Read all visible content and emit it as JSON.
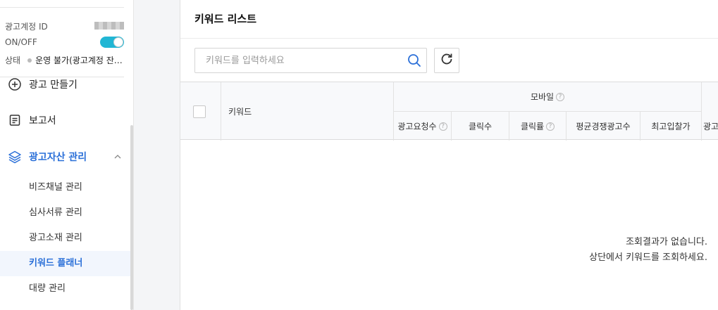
{
  "account": {
    "id_label": "광고계정 ID",
    "onoff_label": "ON/OFF",
    "status_label": "상태",
    "status_value": "운영 불가(광고계정 잔액 부족)"
  },
  "sidebar": {
    "items": [
      {
        "label": "광고 만들기",
        "icon": "plus-circle-icon"
      },
      {
        "label": "보고서",
        "icon": "report-icon"
      },
      {
        "label": "광고자산 관리",
        "icon": "layers-icon"
      }
    ],
    "subitems": [
      "비즈채널 관리",
      "심사서류 관리",
      "광고소재 관리",
      "키워드 플래너",
      "대량 관리"
    ],
    "selected_subitem": "키워드 플래너"
  },
  "main": {
    "title": "키워드 리스트",
    "search": {
      "placeholder": "키워드를 입력하세요"
    },
    "table": {
      "col_keyword": "키워드",
      "group_mobile": "모바일",
      "mobile_columns": [
        "광고요청수",
        "클릭수",
        "클릭률",
        "평균경쟁광고수",
        "최고입찰가"
      ],
      "next_column_partial": "광고"
    },
    "empty": {
      "line1": "조회결과가 없습니다.",
      "line2": "상단에서 키워드를 조회하세요."
    }
  },
  "colors": {
    "accent": "#2a6fd8",
    "toggle": "#21b6d4"
  }
}
